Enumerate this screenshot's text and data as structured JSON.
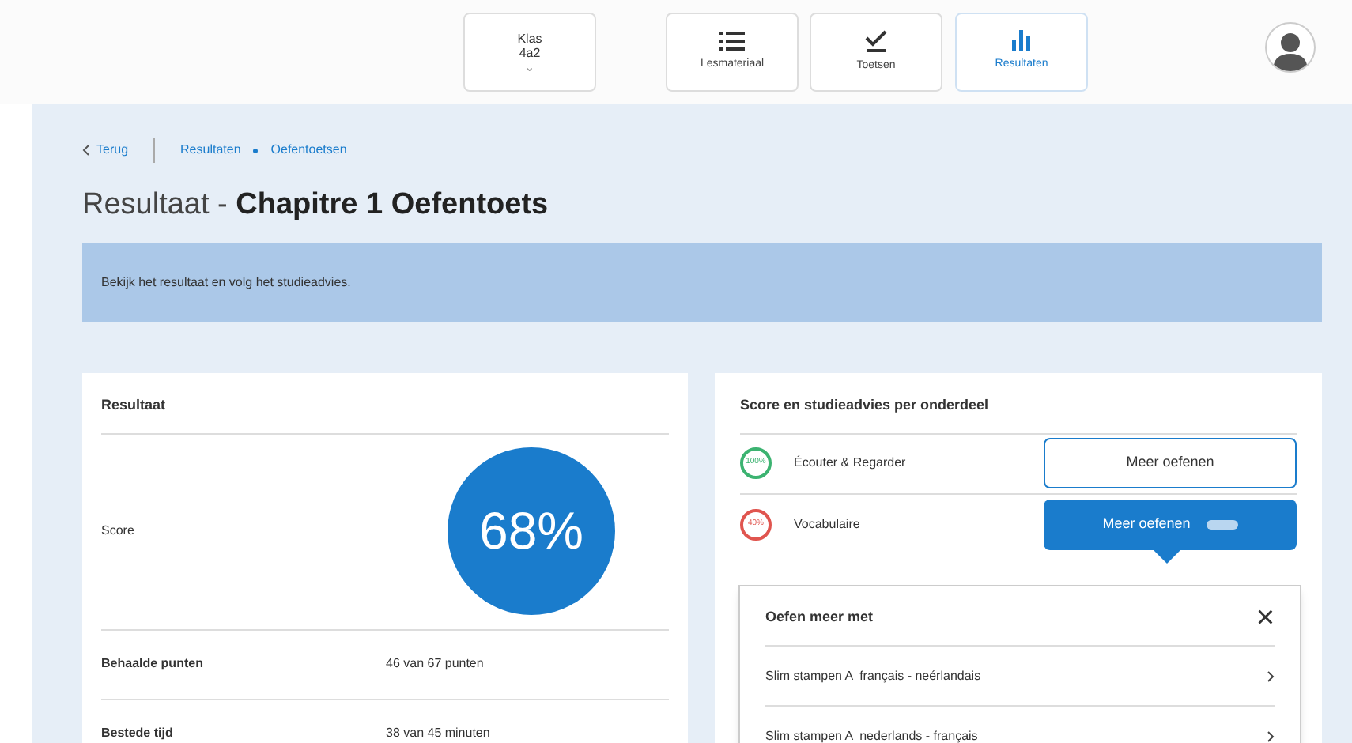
{
  "nav": {
    "class_selector": {
      "label": "Klas",
      "value": "4a2",
      "caret": "⌄"
    },
    "tabs": [
      {
        "label": "Lesmateriaal",
        "kind": "list",
        "selected": false
      },
      {
        "label": "Toetsen",
        "kind": "check",
        "selected": false
      },
      {
        "label": "Resultaten",
        "kind": "bars",
        "selected": true
      }
    ]
  },
  "breadcrumb": {
    "back": "Terug",
    "items": [
      "Resultaten",
      "Oefentoetsen"
    ]
  },
  "title": {
    "prefix": "Resultaat - ",
    "name": "Chapitre 1 Oefentoets"
  },
  "banner": "Bekijk het resultaat en volg het studieadvies.",
  "result_card": {
    "title": "Resultaat",
    "score_label": "Score",
    "score": "68%",
    "rows": [
      {
        "label": "Behaalde punten",
        "value": "46 van 67 punten"
      },
      {
        "label": "Bestede tijd",
        "value": "38 van 45 minuten"
      }
    ]
  },
  "advice_card": {
    "title": "Score en studieadvies per onderdeel",
    "parts": [
      {
        "score": "100%",
        "color": "#3cb371",
        "name": "Écouter & Regarder",
        "button": "Meer oefenen",
        "expanded": false
      },
      {
        "score": "40%",
        "color": "#e0554f",
        "name": "Vocabulaire",
        "button": "Meer oefenen",
        "expanded": true
      }
    ],
    "popover": {
      "title": "Oefen meer met",
      "close": "×",
      "items": [
        {
          "label": "Slim stampen A  français - neérlandais"
        },
        {
          "label": "Slim stampen A  nederlands - français"
        }
      ]
    }
  }
}
